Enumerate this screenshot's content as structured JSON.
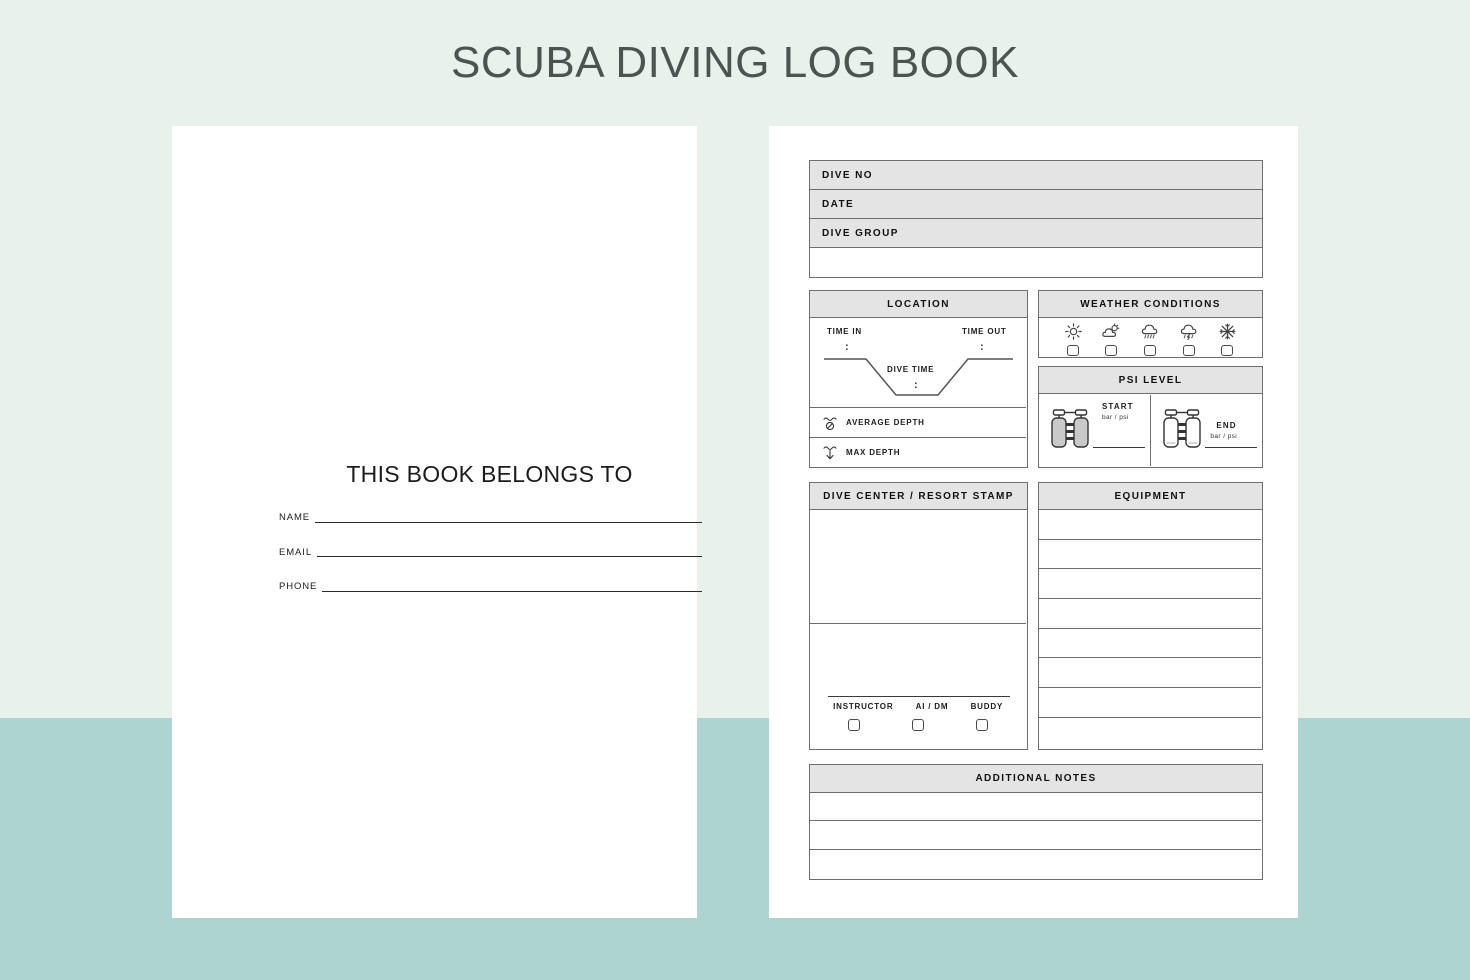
{
  "title": "SCUBA DIVING LOG BOOK",
  "colors": {
    "background_top": "#e9f1ed",
    "background_band": "#aed4d2",
    "page": "#ffffff",
    "header_fill": "#e4e4e4",
    "border": "#6e6e6e",
    "title_text": "#4b5450",
    "ink": "#1c1c1c"
  },
  "left_page": {
    "heading": "THIS BOOK BELONGS TO",
    "fields": [
      {
        "label": "NAME"
      },
      {
        "label": "EMAIL"
      },
      {
        "label": "PHONE"
      }
    ]
  },
  "right_page": {
    "top_rows": [
      {
        "label": "DIVE NO"
      },
      {
        "label": "DATE"
      },
      {
        "label": "DIVE GROUP"
      }
    ],
    "top_blank_row": "",
    "location": {
      "title": "LOCATION",
      "time_in_label": "TIME IN",
      "time_in_value": ":",
      "time_out_label": "TIME OUT",
      "time_out_value": ":",
      "dive_time_label": "DIVE TIME",
      "dive_time_value": ":",
      "average_depth_label": "AVERAGE DEPTH",
      "average_depth_icon": "average-depth-icon",
      "max_depth_label": "MAX DEPTH",
      "max_depth_icon": "max-depth-icon"
    },
    "weather": {
      "title": "WEATHER CONDITIONS",
      "options": [
        {
          "icon": "sun-icon",
          "checked": false
        },
        {
          "icon": "sun-behind-cloud-icon",
          "checked": false
        },
        {
          "icon": "rain-cloud-icon",
          "checked": false
        },
        {
          "icon": "storm-cloud-icon",
          "checked": false
        },
        {
          "icon": "snowflake-icon",
          "checked": false
        }
      ]
    },
    "psi": {
      "title": "PSI LEVEL",
      "start_label": "START",
      "start_unit": "bar / psi",
      "start_icon": "scuba-tanks-full-icon",
      "end_label": "END",
      "end_unit": "bar / psi",
      "end_icon": "scuba-tanks-empty-icon"
    },
    "stamp": {
      "title": "DIVE CENTER / RESORT STAMP",
      "signature_roles": [
        {
          "label": "INSTRUCTOR",
          "checked": false
        },
        {
          "label": "AI / DM",
          "checked": false
        },
        {
          "label": "BUDDY",
          "checked": false
        }
      ]
    },
    "equipment": {
      "title": "EQUIPMENT",
      "rows": [
        "",
        "",
        "",
        "",
        "",
        "",
        "",
        ""
      ]
    },
    "notes": {
      "title": "ADDITIONAL NOTES",
      "rows": [
        "",
        "",
        ""
      ]
    }
  }
}
